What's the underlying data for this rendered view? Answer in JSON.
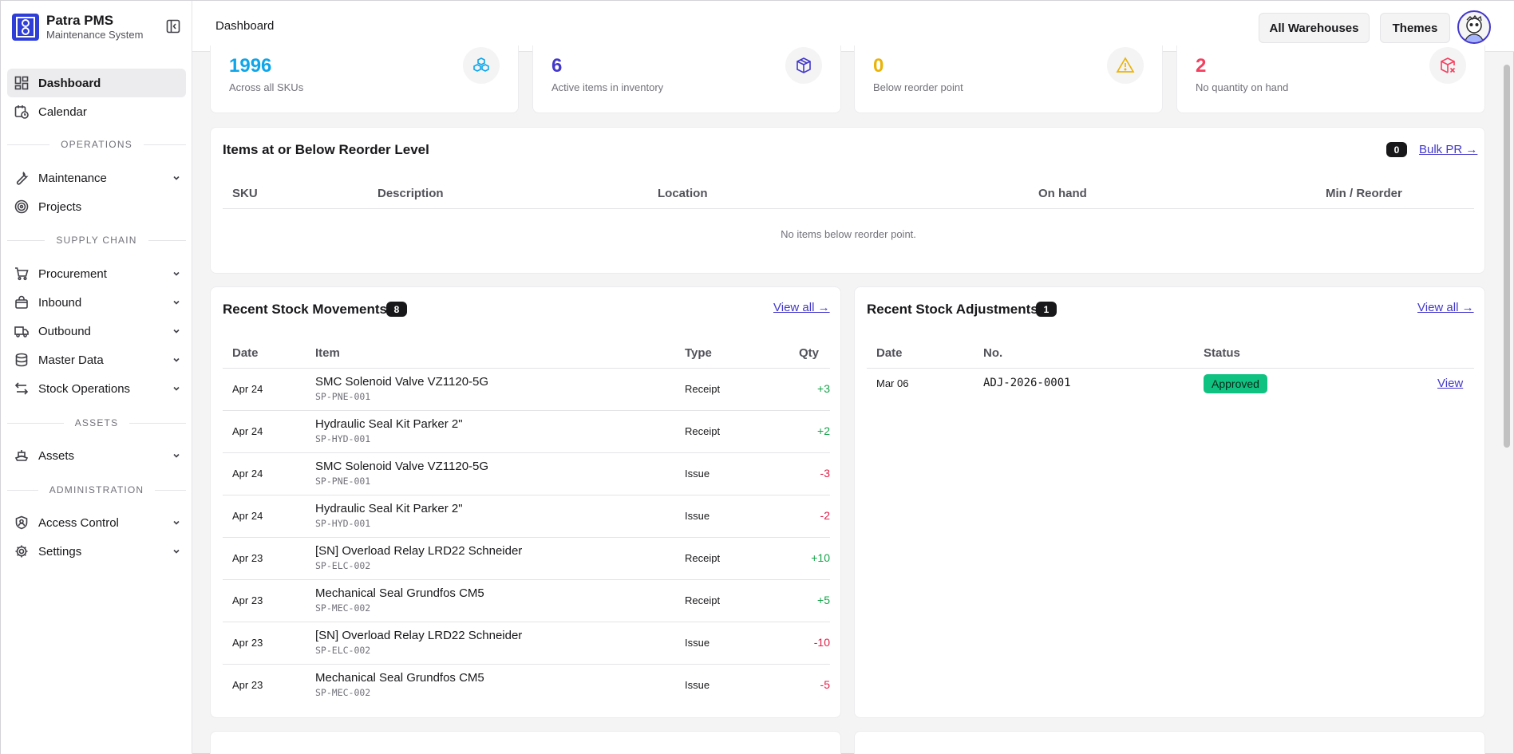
{
  "app": {
    "title": "Patra PMS",
    "subtitle": "Maintenance System"
  },
  "sidebar": {
    "items": [
      {
        "label": "Dashboard",
        "icon": "layout-dashboard-icon"
      },
      {
        "label": "Calendar",
        "icon": "calendar-clock-icon"
      },
      {
        "label": "Maintenance",
        "icon": "wrench-icon"
      },
      {
        "label": "Projects",
        "icon": "target-icon"
      },
      {
        "label": "Procurement",
        "icon": "shopping-cart-icon"
      },
      {
        "label": "Inbound",
        "icon": "shopping-bag-icon"
      },
      {
        "label": "Outbound",
        "icon": "truck-icon"
      },
      {
        "label": "Master Data",
        "icon": "database-icon"
      },
      {
        "label": "Stock Operations",
        "icon": "arrow-left-right-icon"
      },
      {
        "label": "Assets",
        "icon": "ship-icon"
      },
      {
        "label": "Access Control",
        "icon": "shield-user-icon"
      },
      {
        "label": "Settings",
        "icon": "gear-icon"
      }
    ],
    "sections": [
      "OPERATIONS",
      "SUPPLY CHAIN",
      "ASSETS",
      "ADMINISTRATION"
    ]
  },
  "header": {
    "title": "Dashboard",
    "warehouses_label": "All Warehouses",
    "themes_label": "Themes"
  },
  "stats": [
    {
      "value": "1996",
      "label": "Across all SKUs",
      "color": "#0ea5e9",
      "icon": "boxes-icon"
    },
    {
      "value": "6",
      "label": "Active items in inventory",
      "color": "#4338ca",
      "icon": "package-icon"
    },
    {
      "value": "0",
      "label": "Below reorder point",
      "color": "#eab308",
      "icon": "warning-icon"
    },
    {
      "value": "2",
      "label": "No quantity on hand",
      "color": "#f43f5e",
      "icon": "package-x-icon"
    }
  ],
  "reorder": {
    "title": "Items at or Below Reorder Level",
    "count": "0",
    "link": "Bulk PR →",
    "columns": [
      "SKU",
      "Description",
      "Location",
      "On hand",
      "Min / Reorder"
    ],
    "empty": "No items below reorder point."
  },
  "movements": {
    "title": "Recent Stock Movements",
    "count": "8",
    "link": "View all →",
    "columns": [
      "Date",
      "Item",
      "Type",
      "Qty"
    ],
    "rows": [
      {
        "date": "Apr 24",
        "item": "SMC Solenoid Valve VZ1120-5G",
        "sku": "SP-PNE-001",
        "type": "Receipt",
        "qty": "+3",
        "sign": "pos"
      },
      {
        "date": "Apr 24",
        "item": "Hydraulic Seal Kit Parker 2\"",
        "sku": "SP-HYD-001",
        "type": "Receipt",
        "qty": "+2",
        "sign": "pos"
      },
      {
        "date": "Apr 24",
        "item": "SMC Solenoid Valve VZ1120-5G",
        "sku": "SP-PNE-001",
        "type": "Issue",
        "qty": "-3",
        "sign": "neg"
      },
      {
        "date": "Apr 24",
        "item": "Hydraulic Seal Kit Parker 2\"",
        "sku": "SP-HYD-001",
        "type": "Issue",
        "qty": "-2",
        "sign": "neg"
      },
      {
        "date": "Apr 23",
        "item": "[SN] Overload Relay LRD22 Schneider",
        "sku": "SP-ELC-002",
        "type": "Receipt",
        "qty": "+10",
        "sign": "pos"
      },
      {
        "date": "Apr 23",
        "item": "Mechanical Seal Grundfos CM5",
        "sku": "SP-MEC-002",
        "type": "Receipt",
        "qty": "+5",
        "sign": "pos"
      },
      {
        "date": "Apr 23",
        "item": "[SN] Overload Relay LRD22 Schneider",
        "sku": "SP-ELC-002",
        "type": "Issue",
        "qty": "-10",
        "sign": "neg"
      },
      {
        "date": "Apr 23",
        "item": "Mechanical Seal Grundfos CM5",
        "sku": "SP-MEC-002",
        "type": "Issue",
        "qty": "-5",
        "sign": "neg"
      }
    ]
  },
  "adjustments": {
    "title": "Recent Stock Adjustments",
    "count": "1",
    "link": "View all →",
    "columns": [
      "Date",
      "No.",
      "Status"
    ],
    "rows": [
      {
        "date": "Mar 06",
        "no": "ADJ-2026-0001",
        "status": "Approved",
        "action": "View"
      }
    ]
  }
}
